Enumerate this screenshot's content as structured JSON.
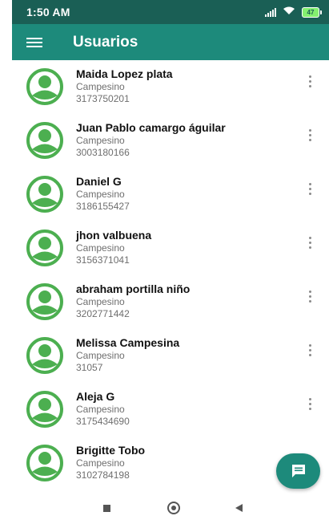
{
  "status_bar": {
    "time": "1:50 AM",
    "battery": "47",
    "icons": [
      "signal-icon",
      "wifi-icon",
      "battery-icon"
    ]
  },
  "app_bar": {
    "title": "Usuarios",
    "menu_icon": "hamburger-menu-icon"
  },
  "users": [
    {
      "name": "Maida Lopez plata",
      "role": "Campesino",
      "phone": "3173750201"
    },
    {
      "name": "Juan Pablo camargo águilar",
      "role": "Campesino",
      "phone": "3003180166"
    },
    {
      "name": "Daniel G",
      "role": "Campesino",
      "phone": "3186155427"
    },
    {
      "name": "jhon valbuena",
      "role": "Campesino",
      "phone": "3156371041"
    },
    {
      "name": "abraham portilla niño",
      "role": "Campesino",
      "phone": "3202771442"
    },
    {
      "name": "Melissa Campesina",
      "role": "Campesino",
      "phone": "31057"
    },
    {
      "name": "Aleja G",
      "role": "Campesino",
      "phone": "3175434690"
    },
    {
      "name": "Brigitte Tobo",
      "role": "Campesino",
      "phone": "3102784198"
    }
  ],
  "fab": {
    "icon": "chat-message-icon"
  },
  "nav_bar": {
    "icons": [
      "recents-square-icon",
      "home-circle-icon",
      "back-triangle-icon"
    ]
  },
  "colors": {
    "status_bar": "#1a5f55",
    "app_bar": "#1d8a7b",
    "avatar": "#4caf50",
    "fab": "#1d8a7b"
  }
}
